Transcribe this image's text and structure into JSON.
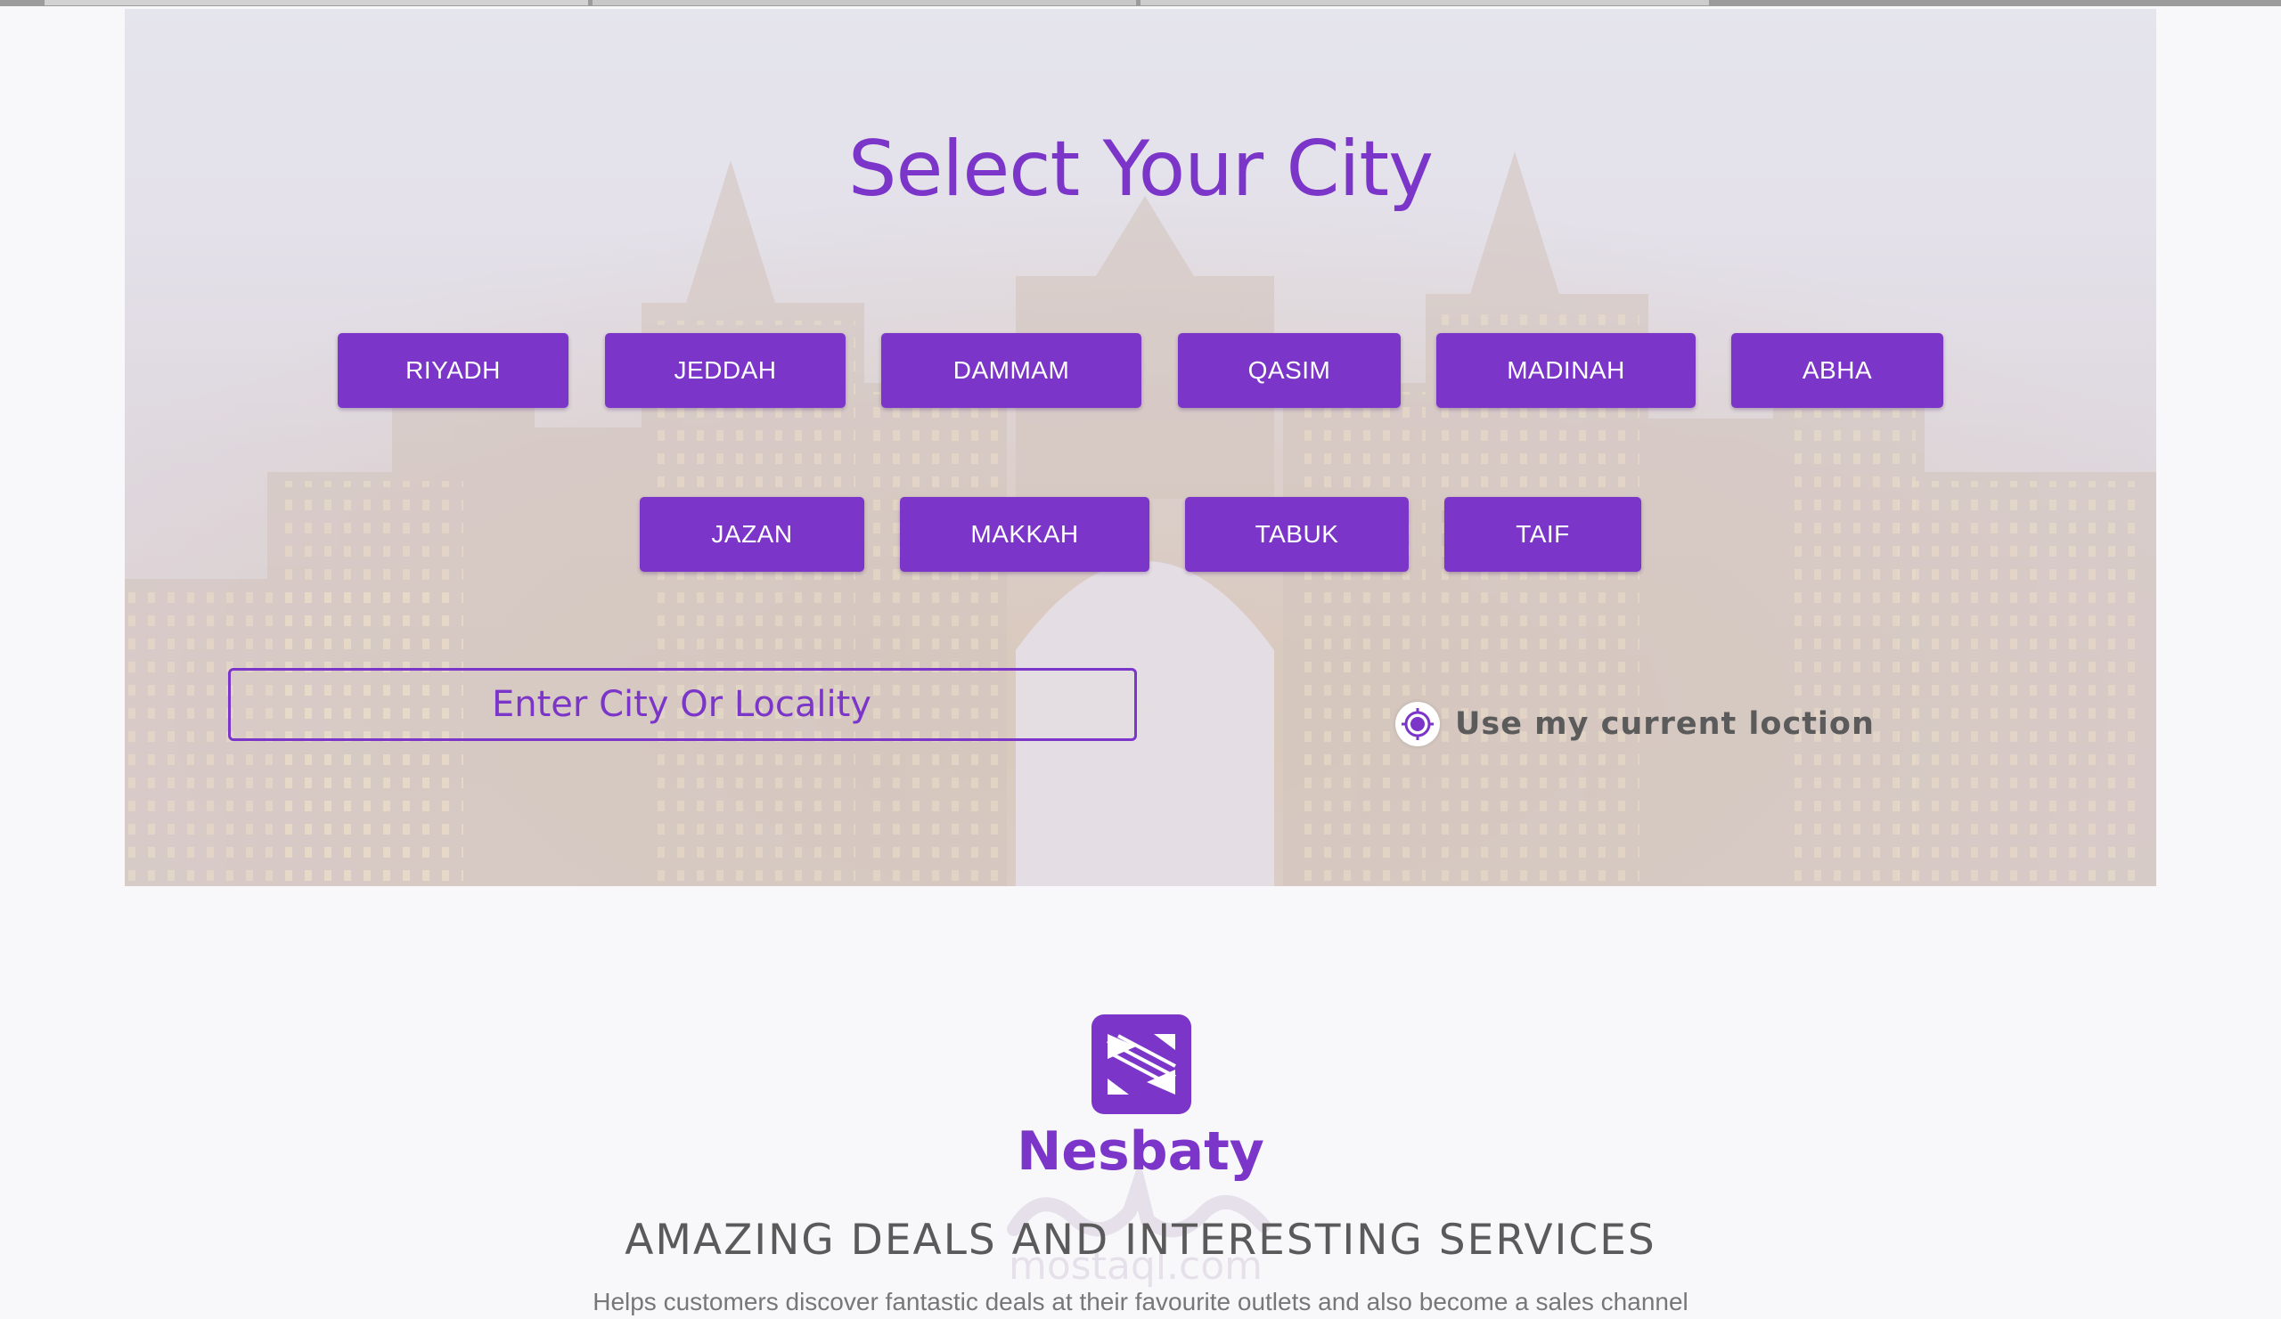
{
  "hero": {
    "title": "Select Your City",
    "cities": [
      "RIYADH",
      "JEDDAH",
      "DAMMAM",
      "QASIM",
      "MADINAH",
      "ABHA",
      "JAZAN",
      "MAKKAH",
      "TABUK",
      "TAIF"
    ],
    "search_placeholder": "Enter City Or Locality",
    "location_label": "Use my current loction"
  },
  "footer": {
    "brand": "Nesbaty",
    "tagline": "AMAZING DEALS AND INTERESTING SERVICES",
    "description": "Helps customers discover fantastic deals at their favourite outlets and also become a sales channel"
  },
  "watermark": {
    "text": "mostaql.com"
  },
  "colors": {
    "accent": "#7b35c8",
    "text_gray": "#5a5a5a",
    "page_bg": "#f8f8fa"
  },
  "icons": {
    "location": "crosshair-icon",
    "logo": "nesbaty-logo-icon"
  }
}
